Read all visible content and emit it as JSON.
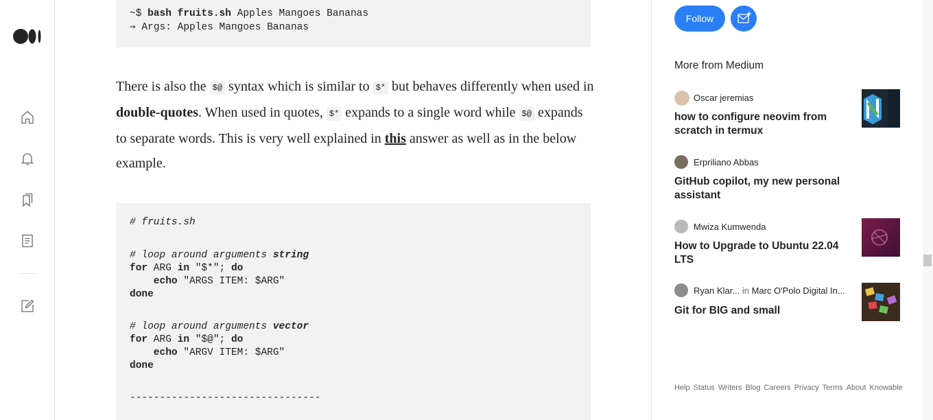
{
  "code_top": {
    "line1": {
      "prompt": "~$ ",
      "cmd": "bash fruits.sh",
      "args": " Apples Mangoes Bananas"
    },
    "line2": "⇒ Args: Apples Mangoes Bananas"
  },
  "paragraph": {
    "t1": "There is also the ",
    "c1": "$@",
    "t2": " syntax which is similar to ",
    "c2": "$*",
    "t3": " but behaves differently when used in ",
    "b1": "double-quotes",
    "t4": ". When used in quotes, ",
    "c3": "$*",
    "t5": " expands to a single word while ",
    "c4": "$@",
    "t6": " expands to separate words. This is very well explained in ",
    "link": "this",
    "t7": " answer as well as in the below example."
  },
  "code_block": {
    "l1": "# fruits.sh",
    "l2a": "# loop around arguments ",
    "l2b": "string",
    "l3a": "for",
    "l3b": " ARG ",
    "l3c": "in",
    "l3d": " \"$*\"; ",
    "l3e": "do",
    "l4a": "    echo",
    "l4b": " \"ARGS ITEM: $ARG\"",
    "l5": "done",
    "l6a": "# loop around arguments ",
    "l6b": "vector",
    "l7a": "for",
    "l7b": " ARG ",
    "l7c": "in",
    "l7d": " \"$@\"; ",
    "l7e": "do",
    "l8a": "    echo",
    "l8b": " \"ARGV ITEM: $ARG\"",
    "l9": "done",
    "l10": "--------------------------------"
  },
  "sidebar": {
    "follow_label": "Follow",
    "more_from": "More from Medium",
    "stories": [
      {
        "author": "Oscar jeremias",
        "publication": "",
        "title": "how to configure neovim from scratch in termux"
      },
      {
        "author": "Erpriliano Abbas",
        "publication": "",
        "title": "GitHub copilot, my new personal assistant"
      },
      {
        "author": "Mwiza Kumwenda",
        "publication": "",
        "title": "How to Upgrade to Ubuntu 22.04 LTS"
      },
      {
        "author": "Ryan Klar...",
        "in": "in",
        "publication": "Marc O'Polo Digital In...",
        "title": "Git for BIG and small"
      }
    ],
    "footer_links": [
      "Help",
      "Status",
      "Writers",
      "Blog",
      "Careers",
      "Privacy",
      "Terms",
      "About",
      "Knowable"
    ]
  },
  "colors": {
    "accent": "#2a7ff5",
    "text": "#242424",
    "code_bg": "#f2f2f2",
    "muted": "#6b6b6b"
  },
  "icons": [
    "medium-logo-icon",
    "home-icon",
    "bell-icon",
    "bookmarks-icon",
    "stories-icon",
    "write-icon",
    "subscribe-mail-icon"
  ]
}
